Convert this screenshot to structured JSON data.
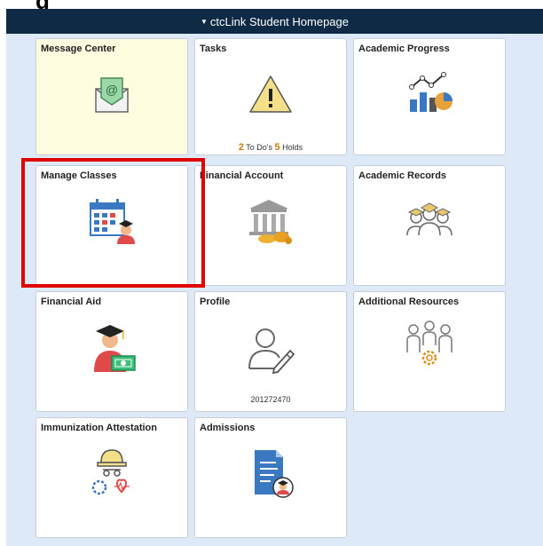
{
  "page": {
    "heading_partial": "g"
  },
  "header": {
    "title": "ctcLink Student Homepage",
    "arrow_icon": "triangle-down-icon",
    "bg_color": "#0e2a45"
  },
  "tiles": {
    "message_center": {
      "title": "Message Center",
      "icon": "envelope-at-icon"
    },
    "tasks": {
      "title": "Tasks",
      "icon": "warning-icon",
      "todo_count": "2",
      "todo_label": "To Do's",
      "holds_count": "5",
      "holds_label": "Holds"
    },
    "academic_progress": {
      "title": "Academic Progress",
      "icon": "chart-icon"
    },
    "manage_classes": {
      "title": "Manage Classes",
      "icon": "calendar-student-icon"
    },
    "financial_account": {
      "title": "Financial Account",
      "icon": "bank-money-icon"
    },
    "academic_records": {
      "title": "Academic Records",
      "icon": "graduates-icon"
    },
    "financial_aid": {
      "title": "Financial Aid",
      "icon": "student-cash-icon"
    },
    "profile": {
      "title": "Profile",
      "icon": "user-edit-icon",
      "id": "201272470"
    },
    "additional_resources": {
      "title": "Additional Resources",
      "icon": "people-gear-icon"
    },
    "immunization": {
      "title": "Immunization Attestation",
      "icon": "hardhat-heart-icon"
    },
    "admissions": {
      "title": "Admissions",
      "icon": "document-student-icon"
    }
  },
  "colors": {
    "highlight_box": "#e00000",
    "canvas_bg": "#dde9f6",
    "tile_highlight": "#fffde0",
    "accent_orange": "#c97a00"
  }
}
